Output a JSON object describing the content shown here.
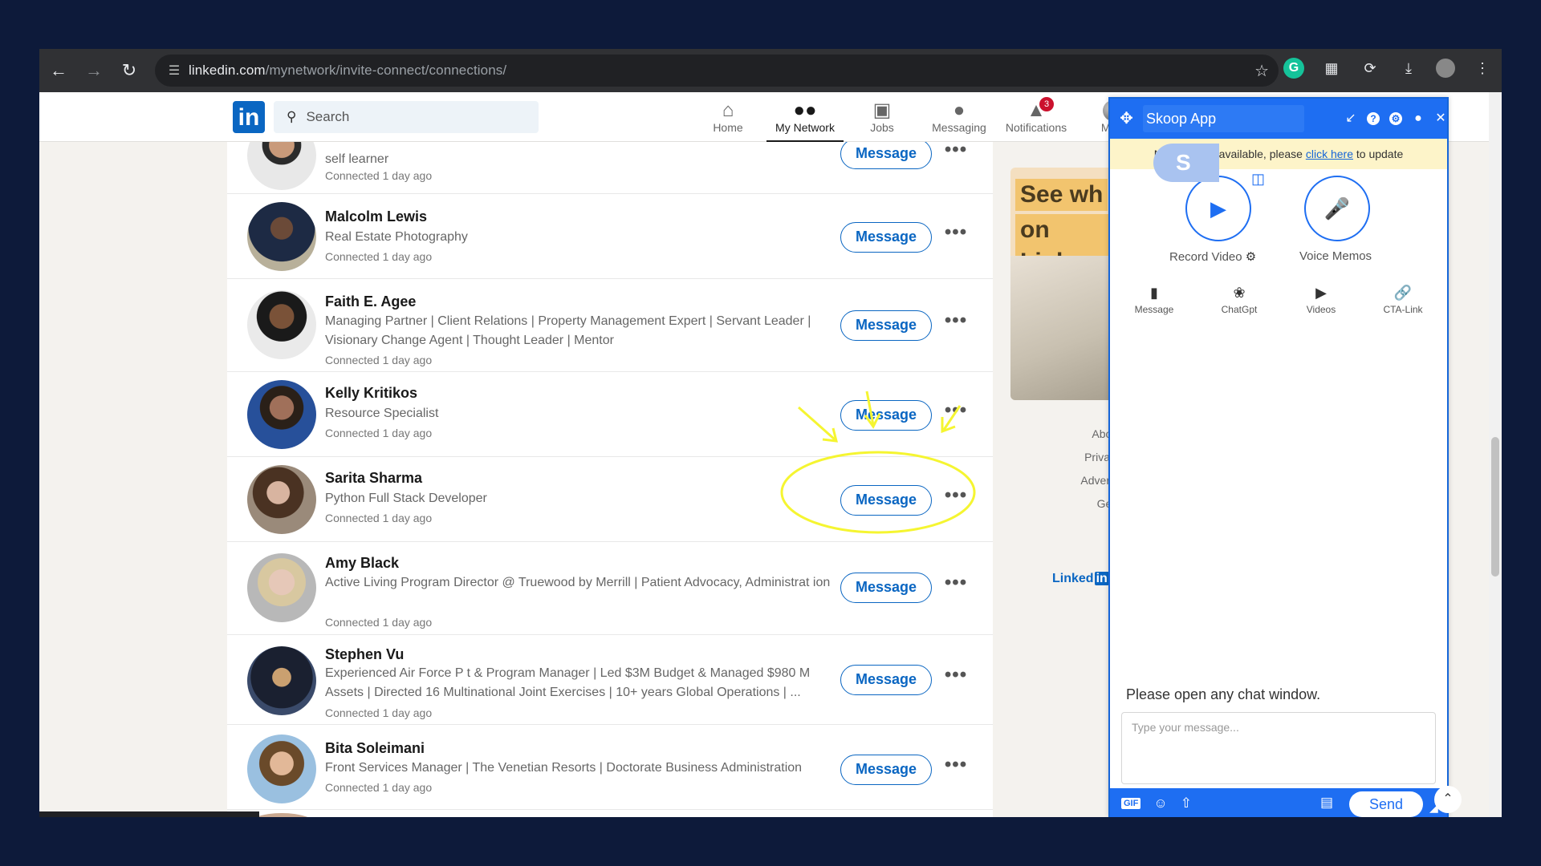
{
  "browser": {
    "url_host": "linkedin.com",
    "url_path": "/mynetwork/invite-connect/connections/"
  },
  "header": {
    "search_placeholder": "Search",
    "nav": [
      {
        "label": "Home",
        "icon": "home-icon"
      },
      {
        "label": "My Network",
        "icon": "network-icon",
        "active": true
      },
      {
        "label": "Jobs",
        "icon": "briefcase-icon"
      },
      {
        "label": "Messaging",
        "icon": "chat-icon"
      },
      {
        "label": "Notifications",
        "icon": "bell-icon",
        "badge": "3"
      },
      {
        "label": "Me",
        "icon": "avatar"
      }
    ]
  },
  "connections": [
    {
      "name": "",
      "headline": "self learner",
      "connected": "Connected 1 day ago",
      "action": "Message"
    },
    {
      "name": "Malcolm Lewis",
      "headline": "Real Estate Photography",
      "connected": "Connected 1 day ago",
      "action": "Message"
    },
    {
      "name": "Faith E. Agee",
      "headline": "Managing Partner | Client Relations | Property Management Expert | Servant Leader | Visionary Change Agent | Thought Leader | Mentor",
      "connected": "Connected 1 day ago",
      "action": "Message"
    },
    {
      "name": "Kelly Kritikos",
      "headline": "Resource Specialist",
      "connected": "Connected 1 day ago",
      "action": "Message"
    },
    {
      "name": "Sarita Sharma",
      "headline": "Python Full Stack Developer",
      "connected": "Connected 1 day ago",
      "action": "Message"
    },
    {
      "name": "Amy Black",
      "headline": "Active Living Program Director @ Truewood by Merrill | Patient Advocacy, Administrat ion",
      "connected": "Connected 1 day ago",
      "action": "Message"
    },
    {
      "name": "Stephen Vu",
      "headline": "Experienced Air Force P t & Program Manager | Led $3M Budget & Managed $980 M Assets | Directed 16 Multinational Joint Exercises | 10+ years Global Operations | ...",
      "connected": "Connected 1 day ago",
      "action": "Message"
    },
    {
      "name": "Bita Soleimani",
      "headline": "Front Services Manager | The Venetian Resorts | Doctorate Business Administration",
      "connected": "Connected 1 day ago",
      "action": "Message"
    }
  ],
  "more_label": "•••",
  "ad": {
    "line1": "See wh",
    "line2": "on Linke"
  },
  "footer_links": [
    "About",
    "Privacy",
    "Advertis",
    "Get t"
  ],
  "footer_logo": "Linked",
  "skoop": {
    "title": "Skoop App",
    "update_text_pre": "New version available, please",
    "update_link": "click here",
    "update_text_post": "to update",
    "s_tab": "S",
    "record_video": "Record Video",
    "voice_memos": "Voice Memos",
    "tools": [
      {
        "label": "Message",
        "icon": "message-icon"
      },
      {
        "label": "ChatGpt",
        "icon": "chatgpt-icon"
      },
      {
        "label": "Videos",
        "icon": "videos-icon"
      },
      {
        "label": "CTA-Link",
        "icon": "link-icon"
      }
    ],
    "chat_hint": "Please open any chat window.",
    "input_placeholder": "Type your message...",
    "gif_label": "GIF",
    "send_label": "Send"
  },
  "colors": {
    "linkedin_blue": "#0a66c2",
    "skoop_blue": "#1e6ef2",
    "highlight_yellow": "#f5f531",
    "backdrop": "#0d1a3a"
  }
}
